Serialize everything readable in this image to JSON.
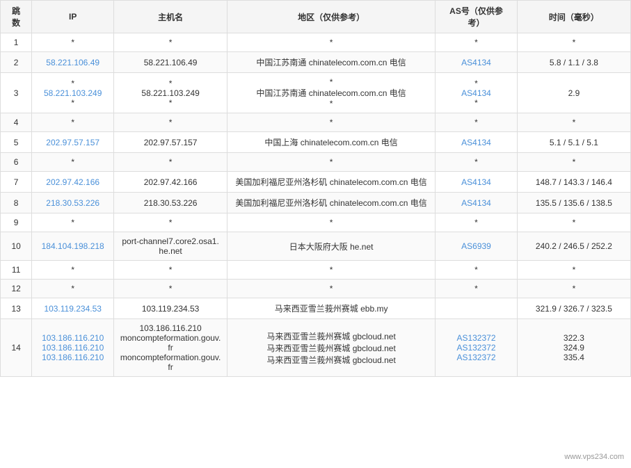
{
  "table": {
    "headers": {
      "hop": "跳\n数",
      "ip": "IP",
      "hostname": "主机名",
      "region": "地区（仅供参考）",
      "as": "AS号（仅供参\n考）",
      "time": "时间（毫秒）"
    },
    "rows": [
      {
        "hop": "1",
        "ip": "*",
        "hostname": "*",
        "region": "*",
        "as": "*",
        "time": "*",
        "ip_link": false,
        "as_link": false
      },
      {
        "hop": "2",
        "ip": "58.221.106.49",
        "hostname": "58.221.106.49",
        "region": "中国江苏南通 chinatelecom.com.cn 电信",
        "as": "AS4134",
        "time": "5.8 / 1.1 / 3.8",
        "ip_link": true,
        "as_link": true
      },
      {
        "hop": "3",
        "ip_multi": [
          "*",
          "58.221.103.249",
          "*"
        ],
        "hostname_multi": [
          "*",
          "58.221.103.249",
          "*"
        ],
        "region_multi": [
          "*",
          "中国江苏南通 chinatelecom.com.cn 电信",
          "*"
        ],
        "as_multi": [
          "*",
          "AS4134",
          "*"
        ],
        "as_link_multi": [
          false,
          true,
          false
        ],
        "ip_link_multi": [
          false,
          true,
          false
        ],
        "time": "2.9",
        "multi": true
      },
      {
        "hop": "4",
        "ip": "*",
        "hostname": "*",
        "region": "*",
        "as": "*",
        "time": "*",
        "ip_link": false,
        "as_link": false
      },
      {
        "hop": "5",
        "ip": "202.97.57.157",
        "hostname": "202.97.57.157",
        "region": "中国上海 chinatelecom.com.cn 电信",
        "as": "AS4134",
        "time": "5.1 / 5.1 / 5.1",
        "ip_link": true,
        "as_link": true
      },
      {
        "hop": "6",
        "ip": "*",
        "hostname": "*",
        "region": "*",
        "as": "*",
        "time": "*",
        "ip_link": false,
        "as_link": false
      },
      {
        "hop": "7",
        "ip": "202.97.42.166",
        "hostname": "202.97.42.166",
        "region": "美国加利福尼亚州洛杉矶 chinatelecom.com.cn 电信",
        "as": "AS4134",
        "time": "148.7 / 143.3 / 146.4",
        "ip_link": true,
        "as_link": true
      },
      {
        "hop": "8",
        "ip": "218.30.53.226",
        "hostname": "218.30.53.226",
        "region": "美国加利福尼亚州洛杉矶 chinatelecom.com.cn 电信",
        "as": "AS4134",
        "time": "135.5 / 135.6 / 138.5",
        "ip_link": true,
        "as_link": true
      },
      {
        "hop": "9",
        "ip": "*",
        "hostname": "*",
        "region": "*",
        "as": "*",
        "time": "*",
        "ip_link": false,
        "as_link": false
      },
      {
        "hop": "10",
        "ip": "184.104.198.218",
        "hostname": "port-channel7.core2.osa1.he.net",
        "region": "日本大阪府大阪 he.net",
        "as": "AS6939",
        "time": "240.2 / 246.5 / 252.2",
        "ip_link": true,
        "as_link": true
      },
      {
        "hop": "11",
        "ip": "*",
        "hostname": "*",
        "region": "*",
        "as": "*",
        "time": "*",
        "ip_link": false,
        "as_link": false
      },
      {
        "hop": "12",
        "ip": "*",
        "hostname": "*",
        "region": "*",
        "as": "*",
        "time": "*",
        "ip_link": false,
        "as_link": false
      },
      {
        "hop": "13",
        "ip": "103.119.234.53",
        "hostname": "103.119.234.53",
        "region": "马来西亚雪兰莪州赛城 ebb.my",
        "as": "",
        "time": "321.9 / 326.7 / 323.5",
        "ip_link": true,
        "as_link": false
      },
      {
        "hop": "14",
        "ip_multi": [
          "103.186.116.210",
          "103.186.116.210",
          "103.186.116.210"
        ],
        "hostname_multi": [
          "103.186.116.210",
          "moncompteformation.gouv.fr",
          "moncompteformation.gouv.fr"
        ],
        "region_multi": [
          "马来西亚雪兰莪州赛城 gbcloud.net",
          "马来西亚雪兰莪州赛城 gbcloud.net",
          "马来西亚雪兰莪州赛城 gbcloud.net"
        ],
        "as_multi": [
          "AS132372",
          "AS132372",
          "AS132372"
        ],
        "as_link_multi": [
          true,
          true,
          true
        ],
        "ip_link_multi": [
          true,
          true,
          true
        ],
        "time_multi": [
          "322.3",
          "324.9",
          "335.4"
        ],
        "multi": true
      }
    ],
    "watermark": "www.vps234.com"
  }
}
